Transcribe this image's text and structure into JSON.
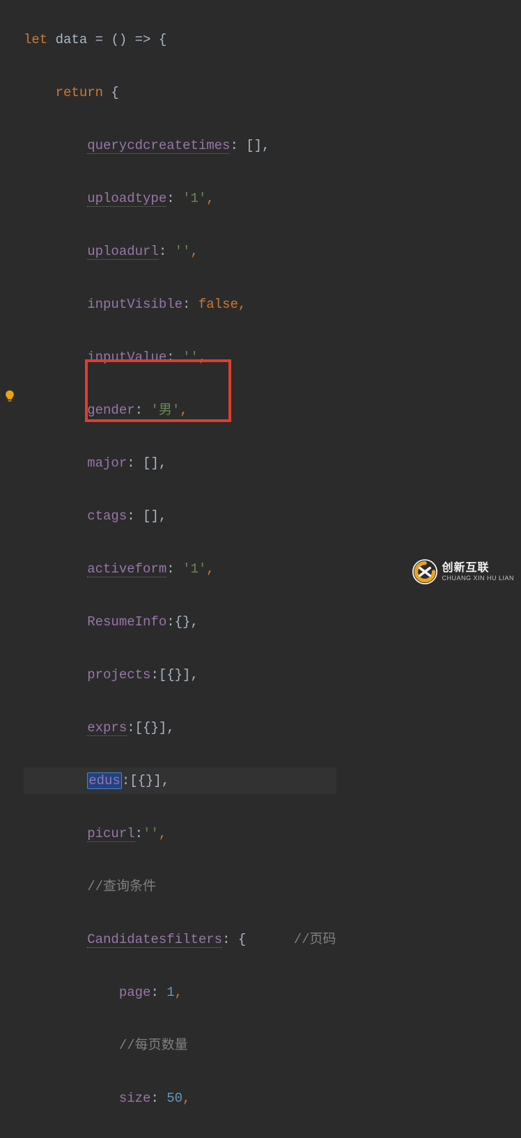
{
  "code": {
    "kw_let": "let",
    "var_data": "data",
    "arrow_open": " = () => {",
    "kw_return": "return",
    "open_brace": " {",
    "props": {
      "querycdcreatetimes": "querycdcreatetimes",
      "querycdcreatetimes_val": ": [],",
      "uploadtype": "uploadtype",
      "uploadtype_val": ": ",
      "uploadtype_str": "'1'",
      "uploadurl": "uploadurl",
      "uploadurl_val": ": ",
      "uploadurl_str": "''",
      "inputVisible": "inputVisible",
      "inputVisible_val": ": ",
      "inputVisible_bool": "false",
      "inputValue": "inputValue",
      "inputValue_val": ": ",
      "inputValue_str": "''",
      "gender": "gender",
      "gender_val": ": ",
      "gender_str": "'男'",
      "major": "major",
      "major_val": ": [],",
      "ctags": "ctags",
      "ctags_val": ": [],",
      "activeform": "activeform",
      "activeform_val": ": ",
      "activeform_str": "'1'",
      "ResumeInfo": "ResumeInfo",
      "ResumeInfo_val": ":{},",
      "projects": "projects",
      "projects_val": ":[{}],",
      "exprs": "exprs",
      "exprs_val": ":[{}],",
      "edus": "edus",
      "edus_val": ":[{}],",
      "picurl": "picurl",
      "picurl_val": ":",
      "picurl_str": "''",
      "cmt_query": "//查询条件",
      "Candidatesfilters": "Candidatesfilters",
      "Candidatesfilters_val": ": {      ",
      "cmt_page": "//页码",
      "page": "page",
      "page_val": ": ",
      "page_num": "1",
      "cmt_perpage": "//每页数量",
      "size": "size",
      "size_val": ": ",
      "size_num": "50"
    }
  },
  "watermark": {
    "big": "创新互联",
    "small": "CHUANG XIN HU LIAN"
  }
}
